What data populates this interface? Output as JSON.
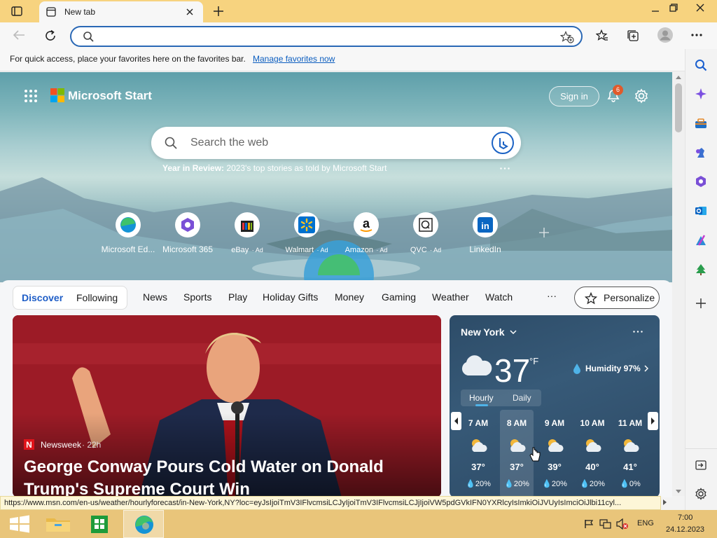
{
  "browser": {
    "tab_title": "New tab",
    "address_value": "",
    "favbar_text": "For quick access, place your favorites here on the favorites bar.",
    "favbar_link": "Manage favorites now"
  },
  "start": {
    "brand": "Microsoft Start",
    "sign_in": "Sign in",
    "notif_count": "6",
    "search_placeholder": "Search the web",
    "yir_bold": "Year in Review:",
    "yir_text": "2023's top stories as told by Microsoft Start",
    "quicklinks": [
      {
        "label": "Microsoft Ed...",
        "ad": ""
      },
      {
        "label": "Microsoft 365",
        "ad": ""
      },
      {
        "label": "eBay",
        "ad": "· Ad"
      },
      {
        "label": "Walmart",
        "ad": "· Ad"
      },
      {
        "label": "Amazon",
        "ad": "· Ad"
      },
      {
        "label": "QVC",
        "ad": "· Ad"
      },
      {
        "label": "LinkedIn",
        "ad": ""
      }
    ]
  },
  "nav": {
    "discover": "Discover",
    "following": "Following",
    "items": [
      "News",
      "Sports",
      "Play",
      "Holiday Gifts",
      "Money",
      "Gaming",
      "Weather",
      "Watch"
    ],
    "more": "···",
    "personalize": "Personalize"
  },
  "news": {
    "source": "Newsweek",
    "age": "· 22h",
    "headline1": "George Conway Pours Cold Water on Donald",
    "headline2": "Trump's Supreme Court Win"
  },
  "weather": {
    "city": "New York",
    "temp": "37",
    "unit": "°F",
    "humidity": "Humidity 97%",
    "tab_hourly": "Hourly",
    "tab_daily": "Daily",
    "hours": [
      {
        "time": "7 AM",
        "temp": "37°",
        "precip": "20%"
      },
      {
        "time": "8 AM",
        "temp": "37°",
        "precip": "20%"
      },
      {
        "time": "9 AM",
        "temp": "39°",
        "precip": "20%"
      },
      {
        "time": "10 AM",
        "temp": "40°",
        "precip": "20%"
      },
      {
        "time": "11 AM",
        "temp": "41°",
        "precip": "0%"
      }
    ]
  },
  "status_url": "https://www.msn.com/en-us/weather/hourlyforecast/in-New-York,NY?loc=eyJsIjoiTmV3IFlvcmsiLCJyIjoiTmV3IFlvcmsiLCJjIjoiVW5pdGVkIFN0YXRlcyIsImkiOiJVUyIsImciOiJlbi11cyl...",
  "taskbar": {
    "lang": "ENG",
    "time": "7:00",
    "date": "24.12.2023"
  },
  "colors": {
    "titlebar": "#f7d37f",
    "accent": "#2a68b5",
    "taskbar": "#e9c57a"
  }
}
